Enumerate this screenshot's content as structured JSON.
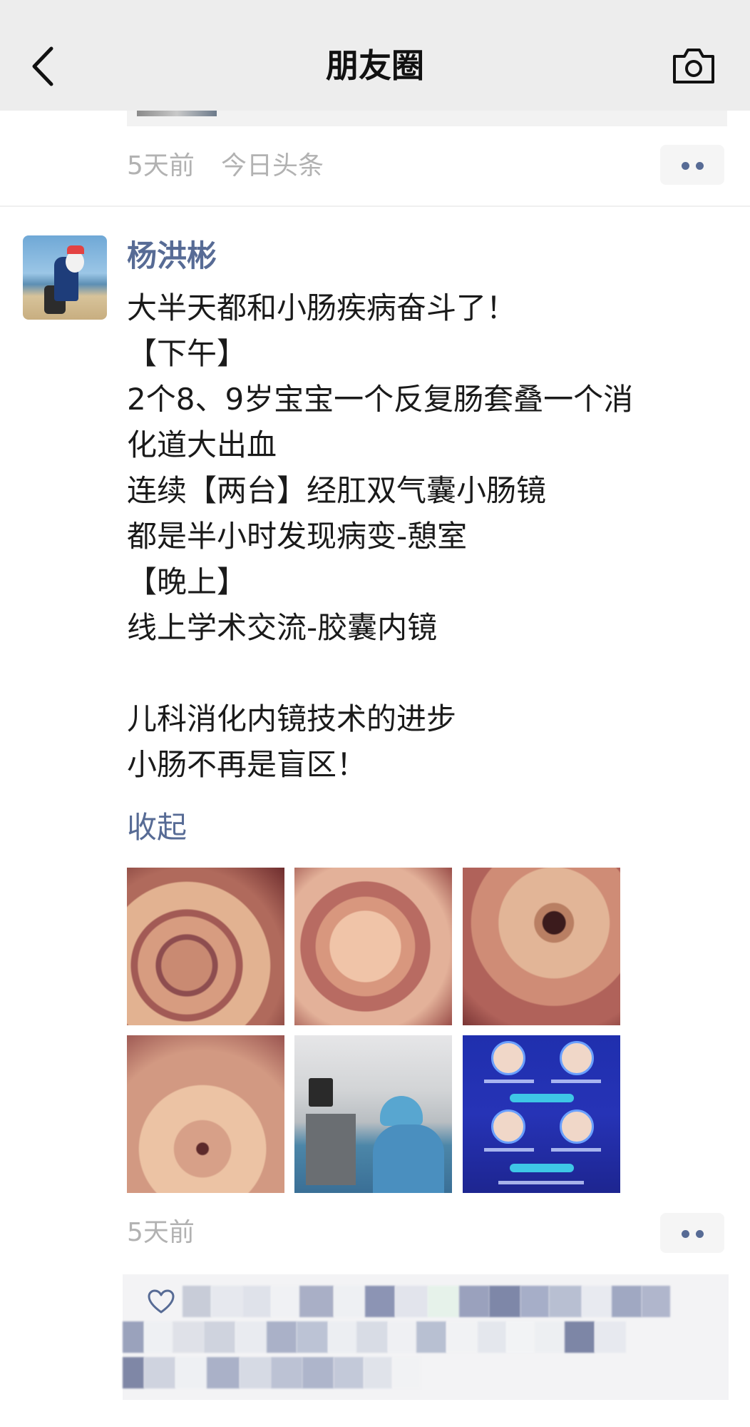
{
  "header": {
    "title": "朋友圈",
    "back_icon": "chevron-left-icon",
    "camera_icon": "camera-icon"
  },
  "previous_post": {
    "time": "5天前",
    "source": "今日头条"
  },
  "post": {
    "author": "杨洪彬",
    "lines": [
      "大半天都和小肠疾病奋斗了！",
      "【下午】",
      "2个8、9岁宝宝一个反复肠套叠一个消",
      "化道大出血",
      "连续【两台】经肛双气囊小肠镜",
      "都是半小时发现病变-憩室",
      "【晚上】",
      "线上学术交流-胶囊内镜",
      "",
      "儿科消化内镜技术的进步",
      "小肠不再是盲区！"
    ],
    "collapse_label": "收起",
    "images": [
      {
        "name": "endoscopy-image-1"
      },
      {
        "name": "endoscopy-image-2"
      },
      {
        "name": "endoscopy-image-3"
      },
      {
        "name": "endoscopy-image-4"
      },
      {
        "name": "procedure-room-photo"
      },
      {
        "name": "conference-poster"
      }
    ],
    "time": "5天前"
  },
  "likes": {
    "icon": "heart-icon"
  },
  "colors": {
    "link": "#576b95",
    "header_bg": "#ededed",
    "meta_text": "#b2b2b2"
  }
}
